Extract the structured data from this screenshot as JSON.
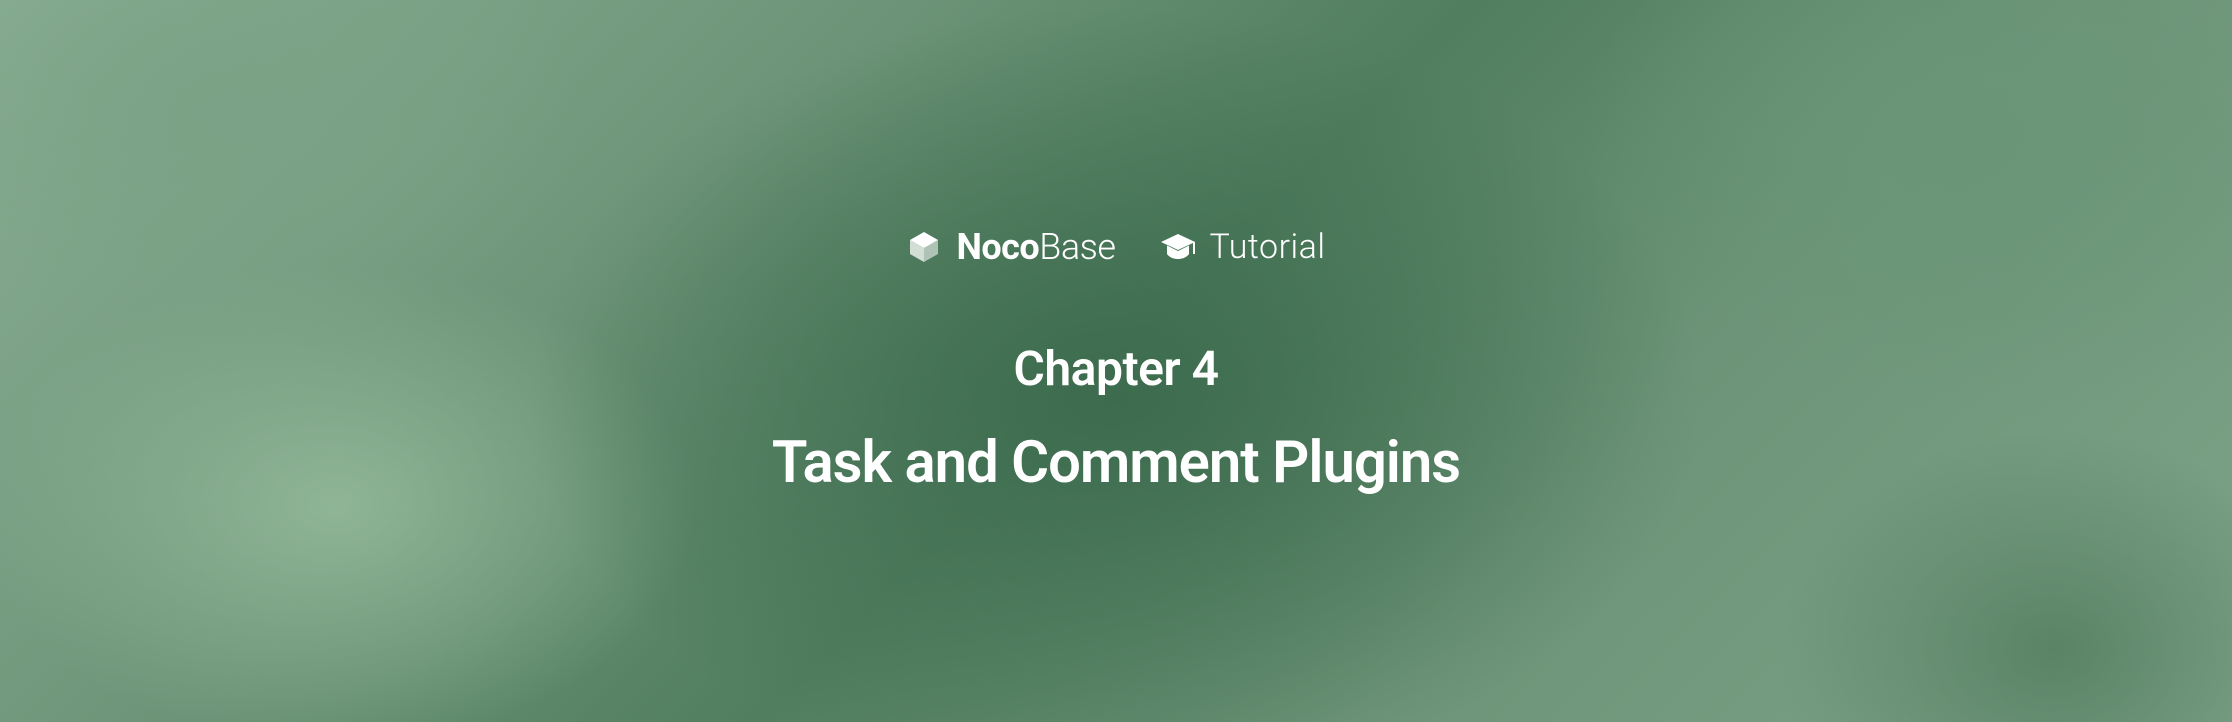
{
  "brand": {
    "name_bold": "Noco",
    "name_light": "Base",
    "tutorial_label": "Tutorial"
  },
  "content": {
    "chapter_label": "Chapter 4",
    "chapter_title": "Task and Comment Plugins"
  }
}
